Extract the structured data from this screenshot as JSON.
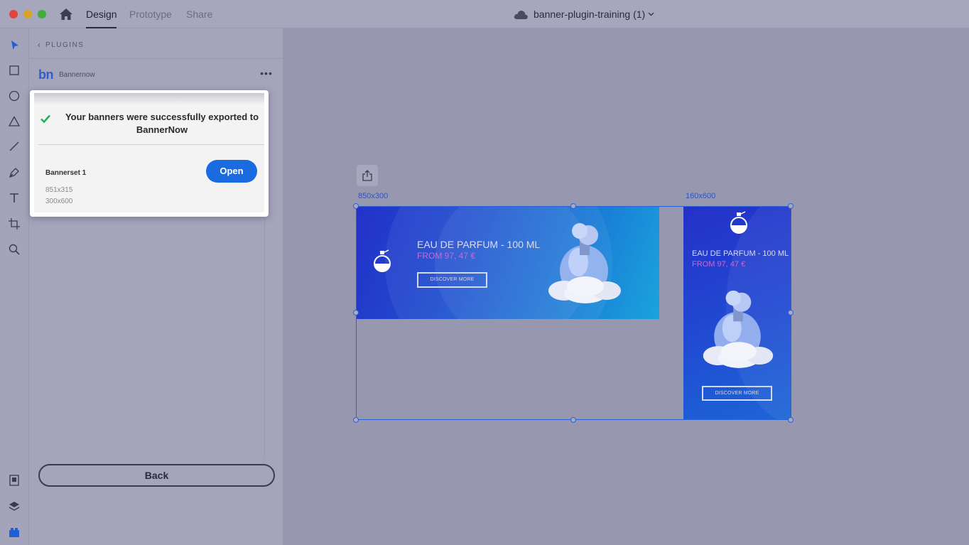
{
  "titlebar": {
    "tabs": [
      {
        "label": "Design",
        "active": true
      },
      {
        "label": "Prototype",
        "active": false
      },
      {
        "label": "Share",
        "active": false
      }
    ],
    "document_title": "banner-plugin-training (1)"
  },
  "panel": {
    "back_label": "PLUGINS",
    "plugin_logo": "bn",
    "plugin_name": "Bannernow",
    "back_button": "Back"
  },
  "dialog": {
    "message": "Your banners were successfully exported to BannerNow",
    "bannerset_name": "Bannerset 1",
    "sizes": [
      "851x315",
      "300x600"
    ],
    "open_button": "Open"
  },
  "canvas": {
    "artboards": [
      {
        "label": "850x300",
        "title": "EAU DE PARFUM - 100 ML",
        "price": "FROM 97, 47 €",
        "cta": "DISCOVER MORE"
      },
      {
        "label": "160x600",
        "title": "EAU DE PARFUM - 100 ML",
        "price": "FROM 97, 47 €",
        "cta": "DISCOVER MORE"
      }
    ]
  },
  "colors": {
    "accent": "#1b6be0",
    "selection": "#2a62d6",
    "success": "#1eb25a",
    "price": "#c46ad8"
  },
  "icons": [
    "home-icon",
    "cloud-icon",
    "chevron-down-icon",
    "select-tool-icon",
    "rectangle-tool-icon",
    "ellipse-tool-icon",
    "polygon-tool-icon",
    "line-tool-icon",
    "pen-tool-icon",
    "text-tool-icon",
    "artboard-tool-icon",
    "zoom-tool-icon",
    "assets-icon",
    "layers-icon",
    "plugins-icon",
    "more-icon",
    "check-icon",
    "export-icon"
  ]
}
